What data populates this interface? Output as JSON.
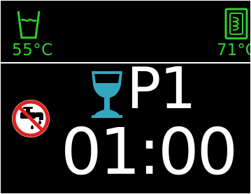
{
  "wash": {
    "icon": "wash-tank-icon",
    "temperature": "55°C",
    "color": "#2fd12f"
  },
  "rinse": {
    "icon": "boiler-heater-icon",
    "temperature": "71°C",
    "color": "#2fd12f"
  },
  "status": {
    "icon": "no-water-faucet-icon"
  },
  "program": {
    "icon": "wine-glass-icon",
    "icon_color": "#34a7c0",
    "label": "P1"
  },
  "timer": {
    "value": "01:00"
  }
}
